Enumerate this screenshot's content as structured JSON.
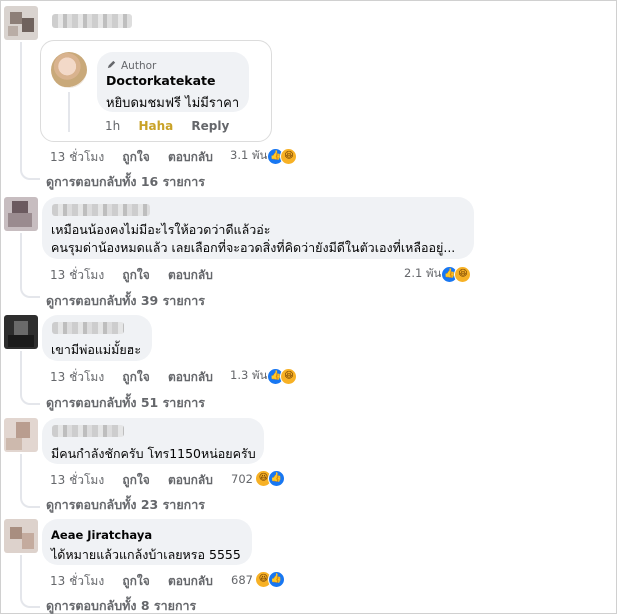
{
  "post_comments": [
    {
      "id": "c1",
      "reply": {
        "badge_label": "Author",
        "name": "Doctorkatekate",
        "text": "หยิบดมชมฟรี ไม่มีราคา",
        "time": "1h",
        "reaction_label": "Haha",
        "reply_label": "Reply"
      },
      "time": "13 ชั่วโมง",
      "like_label": "ถูกใจ",
      "reply_label": "ตอบกลับ",
      "reaction_count": "3.1 พัน",
      "view_replies": "ดูการตอบกลับทั้ง 16 รายการ"
    },
    {
      "id": "c2",
      "lines": [
        "เหมือนน้องคงไม่มีอะไรให้อวดว่าดีแล้วอ่ะ",
        "คนรุมด่าน้องหมดแล้ว เลยเลือกที่จะอวดสิ่งที่คิดว่ายังมีดีในตัวเองที่เหลืออยู่..."
      ],
      "time": "13 ชั่วโมง",
      "like_label": "ถูกใจ",
      "reply_label": "ตอบกลับ",
      "reaction_count": "2.1 พัน",
      "view_replies": "ดูการตอบกลับทั้ง 39 รายการ"
    },
    {
      "id": "c3",
      "text": "เขามีพ่อแม่มั้ยฮะ",
      "time": "13 ชั่วโมง",
      "like_label": "ถูกใจ",
      "reply_label": "ตอบกลับ",
      "reaction_count": "1.3 พัน",
      "view_replies": "ดูการตอบกลับทั้ง 51 รายการ"
    },
    {
      "id": "c4",
      "text": "มีคนกำลังชักครับ โทร1150หน่อยครับ",
      "time": "13 ชั่วโมง",
      "like_label": "ถูกใจ",
      "reply_label": "ตอบกลับ",
      "reaction_count": "702",
      "view_replies": "ดูการตอบกลับทั้ง 23 รายการ"
    },
    {
      "id": "c5",
      "name": "Aeae Jiratchaya",
      "text": "ได้หมายแล้วแกล้งบ้าเลยหรอ 5555",
      "time": "13 ชั่วโมง",
      "like_label": "ถูกใจ",
      "reply_label": "ตอบกลับ",
      "reaction_count": "687",
      "view_replies": "ดูการตอบกลับทั้ง 8 รายการ"
    }
  ],
  "icons": {
    "like": "like-reaction-icon",
    "haha": "haha-reaction-icon",
    "badge": "pencil-icon"
  },
  "colors": {
    "bubble": "#f0f2f5",
    "like_blue": "#1877f2",
    "haha_yellow": "#f7b125",
    "haha_text": "#c9a227",
    "muted": "#65676b"
  }
}
